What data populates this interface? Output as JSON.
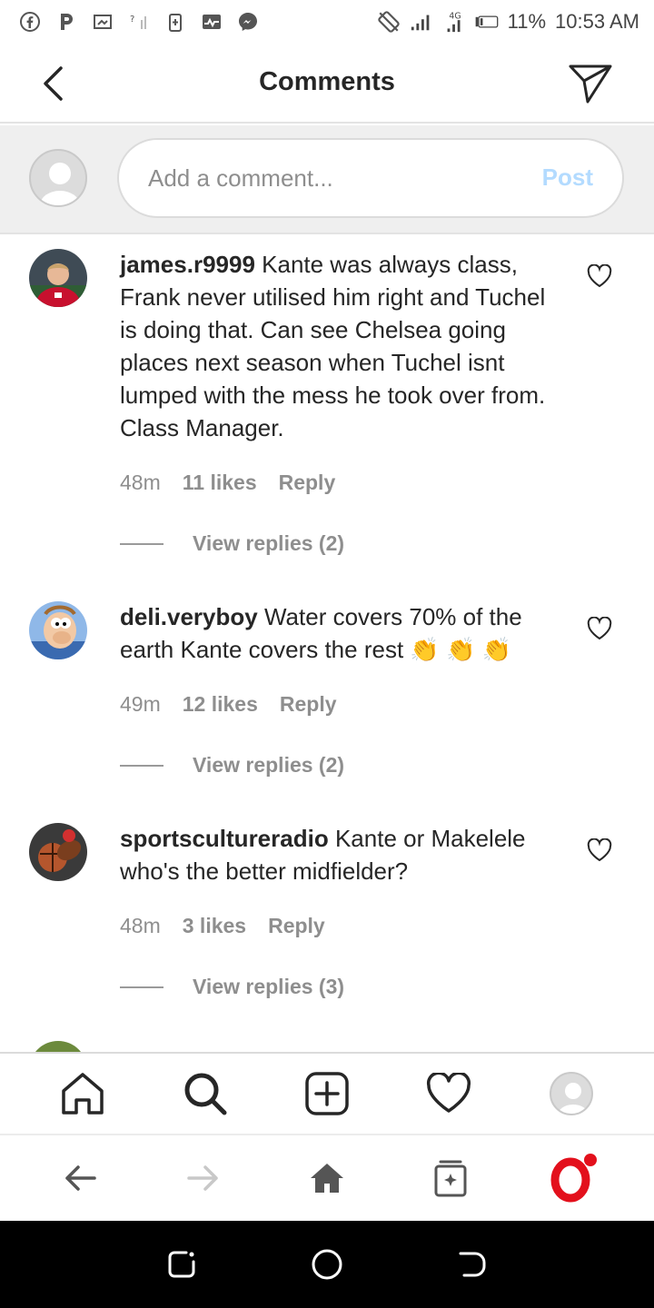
{
  "status_bar": {
    "battery": "11%",
    "time": "10:53 AM",
    "network": "4G"
  },
  "header": {
    "title": "Comments"
  },
  "compose": {
    "placeholder": "Add a comment...",
    "post_label": "Post"
  },
  "comments": [
    {
      "username": "james.r9999",
      "text": "Kante was always class, Frank never utilised him right and Tuchel is doing that. Can see Chelsea going places next season when Tuchel isnt lumped with the mess he took over from. Class Manager.",
      "time": "48m",
      "likes": "11 likes",
      "reply": "Reply",
      "view_replies": "View replies (2)"
    },
    {
      "username": "deli.veryboy",
      "text": "Water covers 70% of the earth Kante covers the rest 👏 👏 👏",
      "time": "49m",
      "likes": "12 likes",
      "reply": "Reply",
      "view_replies": "View replies (2)"
    },
    {
      "username": "sportscultureradio",
      "text": "Kante or Makelele who's the better midfielder?",
      "time": "48m",
      "likes": "3 likes",
      "reply": "Reply",
      "view_replies": "View replies (3)"
    }
  ],
  "colors": {
    "post_disabled": "#b3dbff",
    "meta_gray": "#8e8e8e",
    "opera_red": "#e3101c"
  },
  "icons": {
    "header": [
      "back-arrow-icon",
      "paper-plane-icon"
    ],
    "ig_nav": [
      "home-icon",
      "search-icon",
      "add-post-icon",
      "heart-icon",
      "profile-avatar"
    ],
    "browser": [
      "back-icon",
      "forward-icon",
      "home-icon",
      "tabs-icon",
      "opera-icon"
    ],
    "android": [
      "recents-icon",
      "home-circle-icon",
      "back-icon"
    ]
  }
}
